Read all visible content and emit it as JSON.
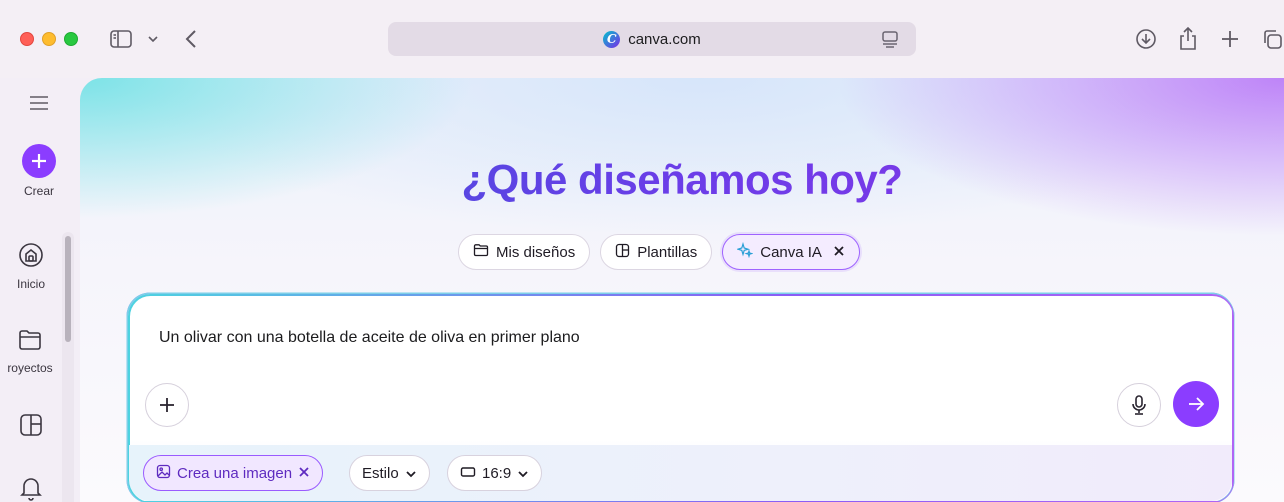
{
  "browser": {
    "url": "canva.com"
  },
  "rail": {
    "create_label": "Crear",
    "items": [
      {
        "label": "Inicio"
      },
      {
        "label": "royectos"
      }
    ]
  },
  "hero": {
    "headline": "¿Qué diseñamos hoy?",
    "tabs": [
      {
        "label": "Mis diseños"
      },
      {
        "label": "Plantillas"
      },
      {
        "label": "Canva IA"
      }
    ]
  },
  "prompt": {
    "text": "Un olivar con una botella de aceite de oliva en primer plano",
    "chips": {
      "image": "Crea una imagen",
      "style": "Estilo",
      "ratio": "16:9"
    }
  },
  "colors": {
    "accent": "#8b3dff",
    "teal": "#00c4cc"
  }
}
